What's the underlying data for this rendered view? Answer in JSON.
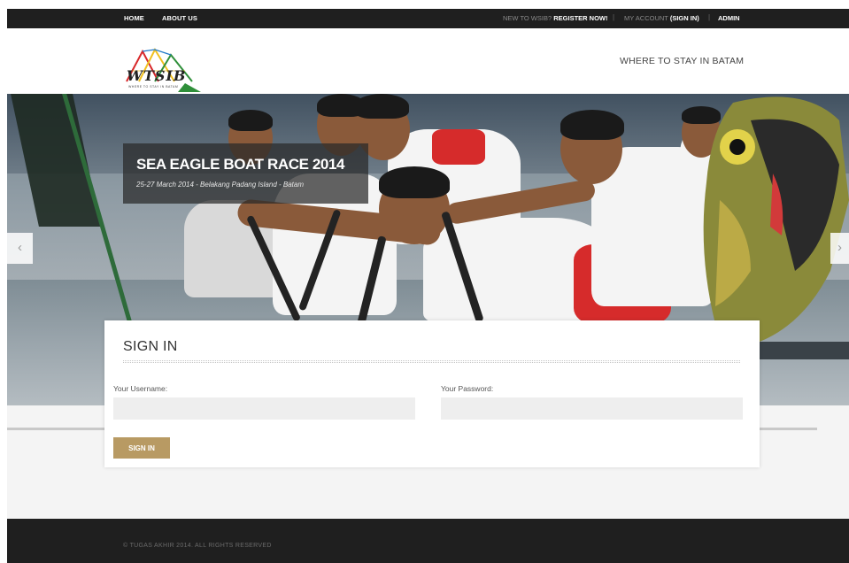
{
  "topnav": {
    "home": "HOME",
    "about": "ABOUT US",
    "new_prefix": "NEW TO WSIB?",
    "register": "REGISTER NOW!",
    "account_prefix": "MY ACCOUNT",
    "sign_in": "(SIGN IN)",
    "admin": "ADMIN",
    "separator": "|"
  },
  "header": {
    "logo_text": "WTSIB",
    "logo_sub": "WHERE TO STAY IN BATAM",
    "tagline": "WHERE TO STAY IN BATAM"
  },
  "slider": {
    "title": "SEA EAGLE BOAT RACE 2014",
    "subtitle": "25-27 March 2014 - Belakang Padang Island - Batam",
    "prev": "‹",
    "next": "›"
  },
  "signin": {
    "title": "SIGN IN",
    "username_label": "Your Username:",
    "username_value": "",
    "password_label": "Your Password:",
    "password_value": "",
    "button": "SIGN IN"
  },
  "footer": {
    "copyright": "© TUGAS AKHIR 2014. ALL RIGHTS RESERVED"
  },
  "colors": {
    "topbar": "#1f1f1f",
    "accent_button": "#b89a63",
    "footer": "#1f1f1f",
    "band": "#f4f4f4"
  }
}
